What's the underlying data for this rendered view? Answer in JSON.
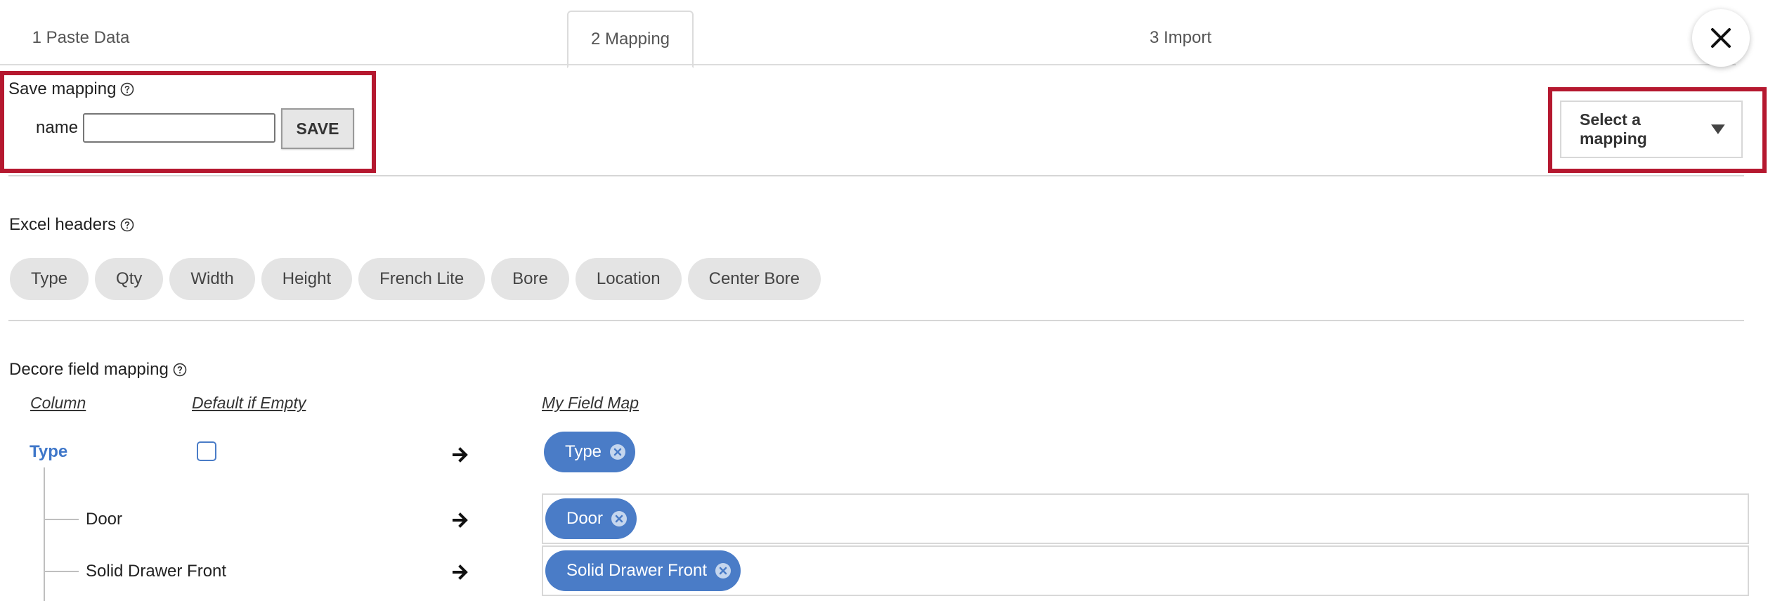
{
  "tabs": [
    {
      "label": "1 Paste Data"
    },
    {
      "label": "2 Mapping"
    },
    {
      "label": "3 Import"
    }
  ],
  "save_mapping": {
    "title": "Save mapping",
    "name_label": "name",
    "name_value": "",
    "save_label": "SAVE"
  },
  "select_mapping": {
    "label": "Select a mapping"
  },
  "excel_headers": {
    "title": "Excel headers",
    "chips": [
      "Type",
      "Qty",
      "Width",
      "Height",
      "French Lite",
      "Bore",
      "Location",
      "Center Bore"
    ]
  },
  "field_mapping": {
    "title": "Decore field mapping",
    "columns": {
      "column": "Column",
      "default_if_empty": "Default if Empty",
      "my_field_map": "My Field Map"
    },
    "rows": [
      {
        "label": "Type",
        "mapped": "Type"
      },
      {
        "label": "Door",
        "mapped": "Door"
      },
      {
        "label": "Solid Drawer Front",
        "mapped": "Solid Drawer Front"
      }
    ]
  },
  "colors": {
    "accent": "#4a7cc7",
    "highlight": "#b5182f",
    "chip_bg": "#e4e4e4"
  }
}
